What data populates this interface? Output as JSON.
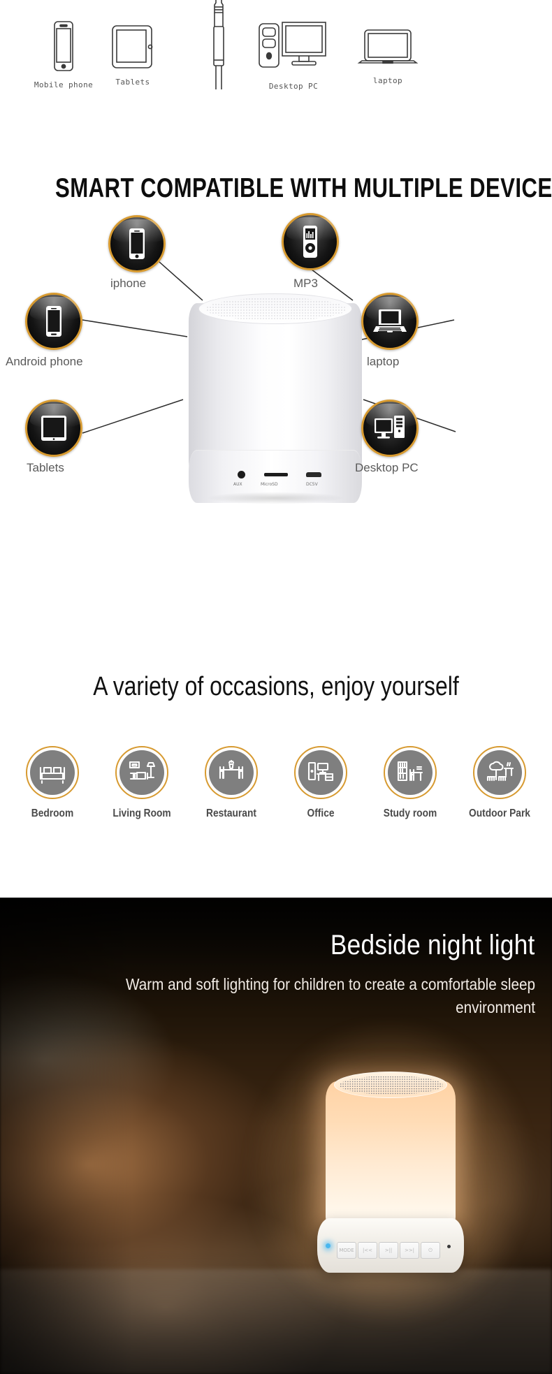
{
  "top_strip": {
    "devices": [
      {
        "label": "Mobile phone",
        "icon": "mobile-phone-icon"
      },
      {
        "label": "Tablets",
        "icon": "tablet-icon"
      },
      {
        "label": "Desktop PC",
        "icon": "desktop-pc-icon"
      },
      {
        "label": "laptop",
        "icon": "laptop-icon"
      }
    ],
    "center_icon": "aux-plug-icon"
  },
  "headline": "SMART COMPATIBLE WITH MULTIPLE DEVICES",
  "hub": {
    "badges": [
      {
        "label": "iphone",
        "icon": "iphone-icon"
      },
      {
        "label": "MP3",
        "icon": "mp3-player-icon"
      },
      {
        "label": "Android phone",
        "icon": "android-phone-icon"
      },
      {
        "label": "laptop",
        "icon": "laptop-icon"
      },
      {
        "label": "Tablets",
        "icon": "tablet-icon"
      },
      {
        "label": "Desktop PC",
        "icon": "desktop-pc-icon"
      }
    ],
    "product": {
      "name": "bluetooth-speaker-lamp",
      "ports": [
        {
          "label": "AUX",
          "icon": "aux-jack-port"
        },
        {
          "label": "MicroSD",
          "icon": "microsd-slot-port"
        },
        {
          "label": "DC5V",
          "icon": "micro-usb-power-port"
        }
      ]
    }
  },
  "subheadline": "A variety of occasions, enjoy yourself",
  "occasions": [
    {
      "label": "Bedroom",
      "icon": "bed-icon"
    },
    {
      "label": "Living Room",
      "icon": "sofa-lamp-icon"
    },
    {
      "label": "Restaurant",
      "icon": "dining-table-icon"
    },
    {
      "label": "Office",
      "icon": "office-desk-icon"
    },
    {
      "label": "Study room",
      "icon": "bookshelf-desk-icon"
    },
    {
      "label": "Outdoor Park",
      "icon": "park-tree-icon"
    }
  ],
  "photo_section": {
    "title": "Bedside night light",
    "subtitle": "Warm and soft lighting for children to create a comfortable sleep environment",
    "lamp_buttons": [
      {
        "label": "MODE",
        "icon": "mode-button"
      },
      {
        "label": "|<<",
        "icon": "previous-track-button"
      },
      {
        "label": ">||",
        "icon": "play-pause-button"
      },
      {
        "label": ">>|",
        "icon": "next-track-button"
      },
      {
        "label": "⏻",
        "icon": "power-button"
      }
    ]
  },
  "colors": {
    "gold_ring": "#d79a30",
    "badge_dark": "#151515",
    "occasion_gray": "#7f7f7f",
    "label_gray": "#5a5a5a",
    "lamp_glow": "#ffd6a0",
    "led_blue": "#49b7ef"
  }
}
